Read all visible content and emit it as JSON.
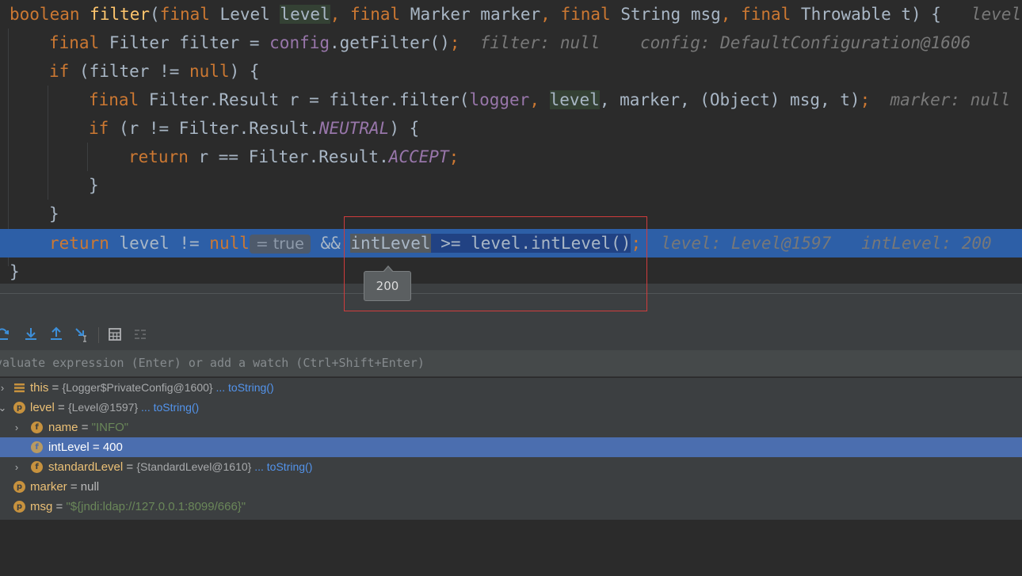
{
  "editor": {
    "l1": {
      "kw_boolean": "boolean",
      "fn": "filter",
      "p1": "(",
      "kw_final1": "final",
      "t_level": " Level ",
      "param_level": "level",
      "c1": ",",
      "kw_final2": " final",
      "t_marker": " Marker marker",
      "c2": ",",
      "kw_final3": " final",
      "t_string": " String msg",
      "c3": ",",
      "kw_final4": " final",
      "t_throw": " Throwable t) {",
      "hint": "level:"
    },
    "l2": {
      "kw_final": "final",
      "t1": " Filter filter = ",
      "cfg": "config",
      "t2": ".getFilter()",
      "semi": ";",
      "hint1": "filter: null",
      "hint2": "config: DefaultConfiguration@1606"
    },
    "l3": {
      "kw_if": "if",
      "t1": " (filter != ",
      "kw_null": "null",
      "t2": ") {"
    },
    "l4": {
      "kw_final": "final",
      "t1": " Filter.Result r = filter.filter(",
      "logger": "logger",
      "c1": ", ",
      "level": "level",
      "t2": ", marker, (Object) msg, t)",
      "semi": ";",
      "hint": "marker: null"
    },
    "l5": {
      "kw_if": "if",
      "t1": " (r != Filter.Result.",
      "cst": "NEUTRAL",
      "t2": ") {"
    },
    "l6": {
      "kw_return": "return",
      "t1": " r == Filter.Result.",
      "cst": "ACCEPT",
      "semi": ";"
    },
    "l7": {
      "brace": "}"
    },
    "l8": {
      "brace": "}"
    },
    "l9": {
      "kw_return": "return",
      "t1": " level != ",
      "kw_null": "null",
      "inline_val": "= true",
      "t2": " && ",
      "intlevel": "intLevel",
      "t3": " >= ",
      "call": "level.intLevel()",
      "semi": ";",
      "hint1": "level: Level@1597",
      "hint2": "intLevel: 200"
    },
    "l10": {
      "brace": "}"
    }
  },
  "tooltip": {
    "value": "200"
  },
  "debugger": {
    "toolbar_icons": [
      "step-into-icon",
      "force-step-into-icon",
      "step-out-icon",
      "run-to-cursor-icon",
      "evaluate-expression-icon",
      "trace-icon"
    ],
    "eval_placeholder": "valuate expression (Enter) or add a watch (Ctrl+Shift+Enter)",
    "variables": [
      {
        "name": "this",
        "eq": " = ",
        "value": "{Logger$PrivateConfig@1600}",
        "link": " ... toString()",
        "icon": "lines-icon"
      },
      {
        "name": "level",
        "eq": " = ",
        "value": "{Level@1597}",
        "link": " ... toString()",
        "icon": "p"
      },
      {
        "name": "name",
        "eq": " = ",
        "value": "\"INFO\"",
        "icon": "f"
      },
      {
        "name": "intLevel",
        "eq": " = ",
        "value": "400",
        "icon": "f"
      },
      {
        "name": "standardLevel",
        "eq": " = ",
        "value": "{StandardLevel@1610}",
        "link": " ... toString()",
        "icon": "f"
      },
      {
        "name": "marker",
        "eq": " = ",
        "value": "null",
        "icon": "p"
      },
      {
        "name": "msg",
        "eq": " = ",
        "value": "\"${jndi:ldap://127.0.0.1:8099/666}\"",
        "icon": "p"
      }
    ]
  }
}
